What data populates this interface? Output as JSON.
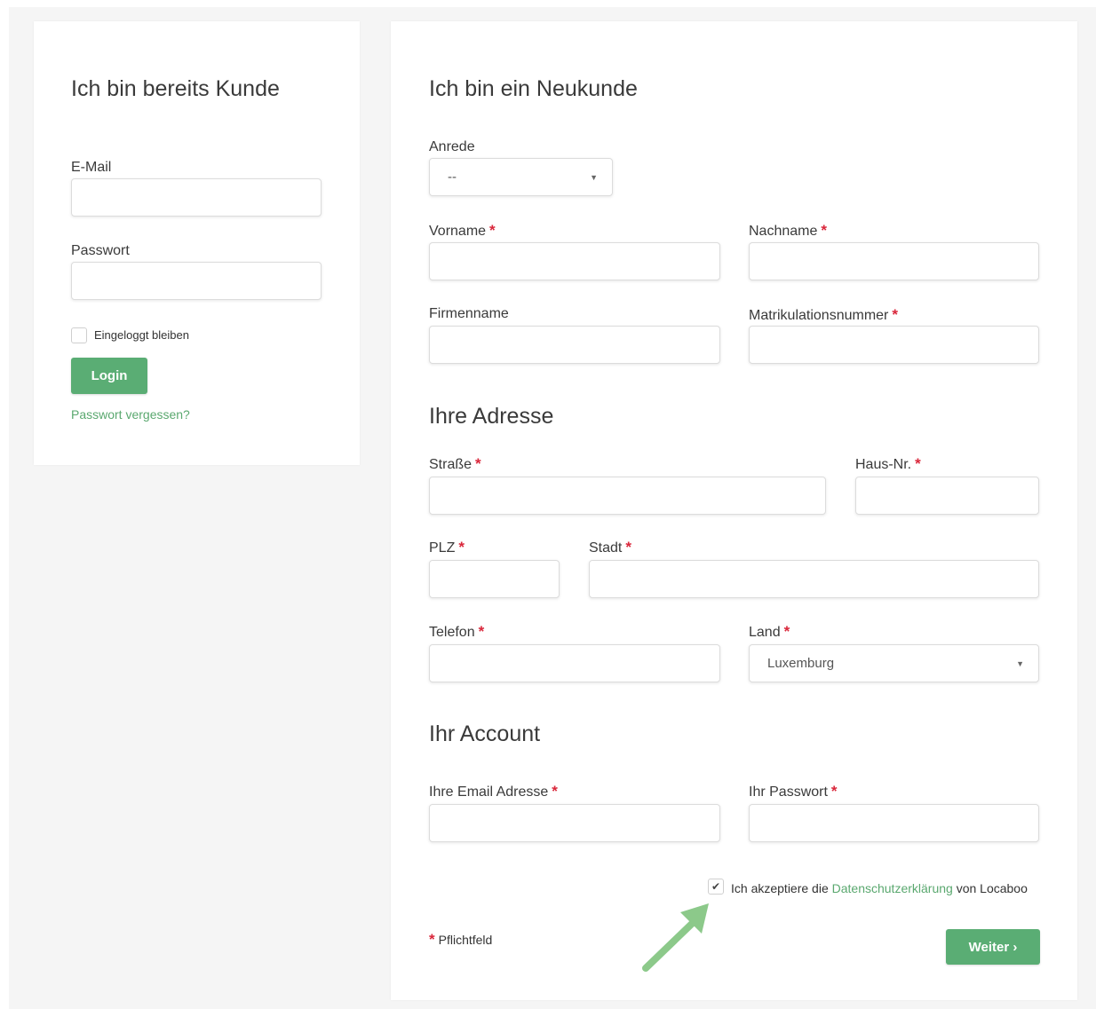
{
  "login": {
    "title": "Ich bin bereits Kunde",
    "email_label": "E-Mail",
    "email_value": "",
    "password_label": "Passwort",
    "password_value": "",
    "remember_label": "Eingeloggt bleiben",
    "remember_checked": false,
    "login_button": "Login",
    "forgot_link": "Passwort vergessen?"
  },
  "register": {
    "title": "Ich bin ein Neukunde",
    "anrede_label": "Anrede",
    "anrede_value": "--",
    "vorname_label": "Vorname",
    "nachname_label": "Nachname",
    "firmenname_label": "Firmenname",
    "matrikel_label": "Matrikulationsnummer",
    "required_mark": "*",
    "address": {
      "title": "Ihre Adresse",
      "strasse_label": "Straße",
      "hausnr_label": "Haus-Nr.",
      "plz_label": "PLZ",
      "stadt_label": "Stadt",
      "telefon_label": "Telefon",
      "land_label": "Land",
      "land_value": "Luxemburg"
    },
    "account": {
      "title": "Ihr Account",
      "email_label": "Ihre Email Adresse",
      "password_label": "Ihr Passwort"
    },
    "privacy": {
      "checked": true,
      "prefix": "Ich akzeptiere die",
      "link": "Datenschutzerklärung",
      "suffix": "von Locaboo"
    },
    "required_note": "Pflichtfeld",
    "submit_button": "Weiter ›"
  },
  "colors": {
    "accent": "#5aad74",
    "link": "#5aa86f",
    "required": "#d9263a",
    "arrow": "#8cc98a"
  },
  "icons": {
    "dropdown": "caret-down-icon",
    "checkmark": "checkmark-icon",
    "annotation": "arrow-icon"
  }
}
